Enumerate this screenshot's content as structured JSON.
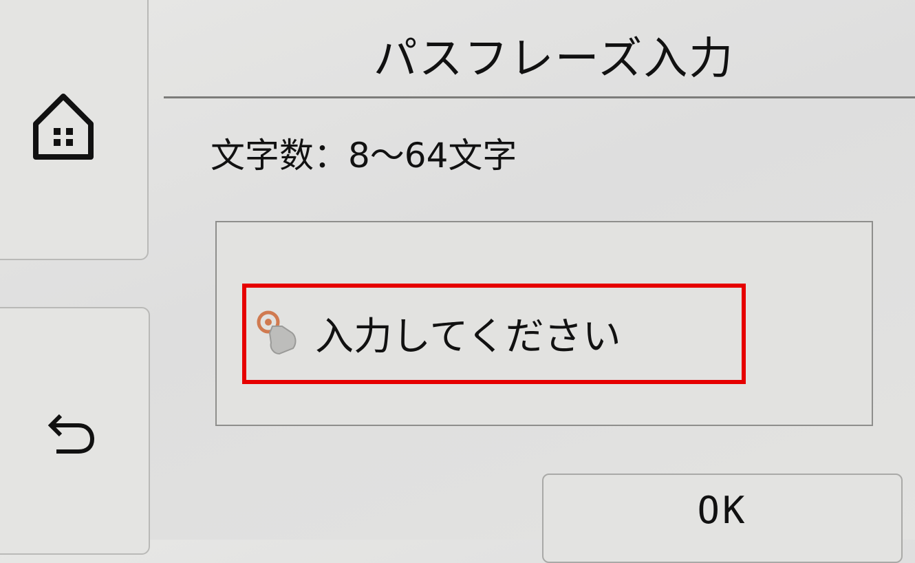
{
  "header": {
    "title": "パスフレーズ入力"
  },
  "info": {
    "length_requirement": "文字数：8～64文字"
  },
  "input": {
    "prompt": "入力してください"
  },
  "buttons": {
    "ok_label": "OK"
  },
  "icons": {
    "home": "home-icon",
    "back": "back-arrow-icon",
    "touch": "touch-hand-icon"
  },
  "colors": {
    "highlight": "#e60000"
  }
}
